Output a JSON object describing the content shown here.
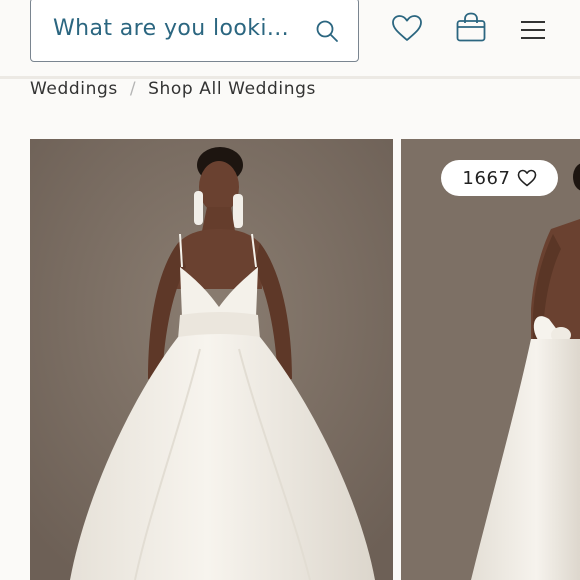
{
  "header": {
    "search": {
      "placeholder": "What are you looki..."
    },
    "icons": {
      "search": "search-icon",
      "wishlist": "heart-icon",
      "bag": "shopping-bag-icon",
      "menu": "hamburger-menu-icon"
    }
  },
  "breadcrumb": {
    "items": [
      "Weddings",
      "Shop All Weddings"
    ],
    "separator": "/"
  },
  "products": [
    {
      "image": "bride-gown-front"
    },
    {
      "image": "bride-gown-back-bow",
      "likes": "1667"
    }
  ],
  "colors": {
    "accent": "#2b6680",
    "background": "#fbfaf8",
    "photo_backdrop": "#7c6f64"
  }
}
